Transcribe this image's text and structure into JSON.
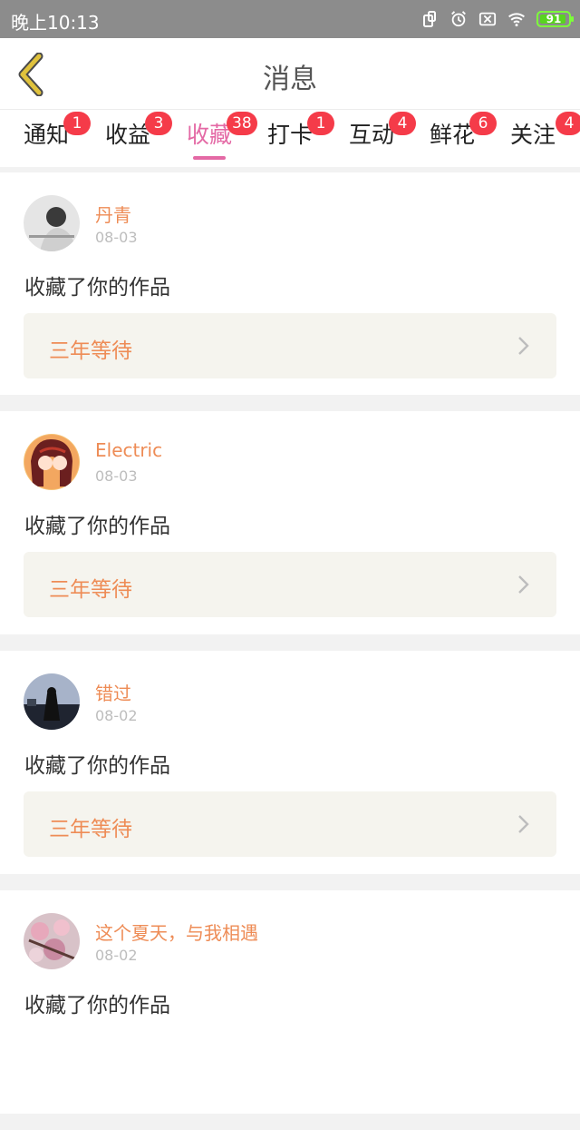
{
  "status_bar": {
    "time": "晚上10:13",
    "battery": "91"
  },
  "header": {
    "title": "消息",
    "back_icon": "back-chevron-icon"
  },
  "tabs": [
    {
      "label": "通知",
      "badge": "1",
      "active": false
    },
    {
      "label": "收益",
      "badge": "3",
      "active": false
    },
    {
      "label": "收藏",
      "badge": "38",
      "active": true
    },
    {
      "label": "打卡",
      "badge": "1",
      "active": false
    },
    {
      "label": "互动",
      "badge": "4",
      "active": false
    },
    {
      "label": "鲜花",
      "badge": "6",
      "active": false
    },
    {
      "label": "关注",
      "badge": "4",
      "active": false
    }
  ],
  "items": [
    {
      "name": "丹青",
      "date": "08-03",
      "action": "收藏了你的作品",
      "work": "三年等待"
    },
    {
      "name": "Electric",
      "date": "08-03",
      "action": "收藏了你的作品",
      "work": "三年等待"
    },
    {
      "name": "错过",
      "date": "08-02",
      "action": "收藏了你的作品",
      "work": "三年等待"
    },
    {
      "name": "这个夏天，与我相遇",
      "date": "08-02",
      "action": "收藏了你的作品",
      "work": ""
    }
  ],
  "colors": {
    "accent": "#e469a5",
    "badge": "#f53b49",
    "name": "#ee8c56",
    "back_icon": "#e0c23c"
  }
}
